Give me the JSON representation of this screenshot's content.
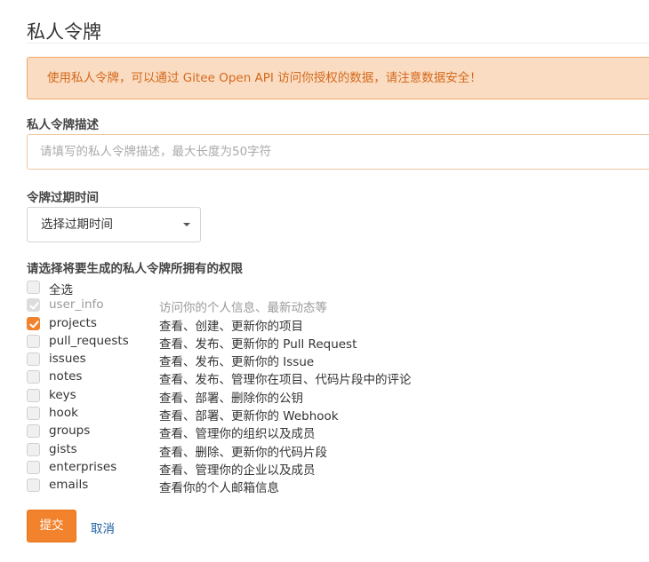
{
  "page": {
    "title": "私人令牌",
    "notice": "使用私人令牌，可以通过 Gitee Open API 访问你授权的数据，请注意数据安全！"
  },
  "form": {
    "description": {
      "label": "私人令牌描述",
      "placeholder": "请填写的私人令牌描述，最大长度为50字符",
      "value": ""
    },
    "expiry": {
      "label": "令牌过期时间",
      "selected": "选择过期时间"
    },
    "permissions": {
      "label": "请选择将要生成的私人令牌所拥有的权限",
      "select_all": {
        "name": "全选",
        "checked": false
      },
      "items": [
        {
          "name": "user_info",
          "desc": "访问你的个人信息、最新动态等",
          "checked": true,
          "disabled": true
        },
        {
          "name": "projects",
          "desc": "查看、创建、更新你的项目",
          "checked": true,
          "disabled": false
        },
        {
          "name": "pull_requests",
          "desc": "查看、发布、更新你的 Pull Request",
          "checked": false,
          "disabled": false
        },
        {
          "name": "issues",
          "desc": "查看、发布、更新你的 Issue",
          "checked": false,
          "disabled": false
        },
        {
          "name": "notes",
          "desc": "查看、发布、管理你在项目、代码片段中的评论",
          "checked": false,
          "disabled": false
        },
        {
          "name": "keys",
          "desc": "查看、部署、删除你的公钥",
          "checked": false,
          "disabled": false
        },
        {
          "name": "hook",
          "desc": "查看、部署、更新你的 Webhook",
          "checked": false,
          "disabled": false
        },
        {
          "name": "groups",
          "desc": "查看、管理你的组织以及成员",
          "checked": false,
          "disabled": false
        },
        {
          "name": "gists",
          "desc": "查看、删除、更新你的代码片段",
          "checked": false,
          "disabled": false
        },
        {
          "name": "enterprises",
          "desc": "查看、管理你的企业以及成员",
          "checked": false,
          "disabled": false
        },
        {
          "name": "emails",
          "desc": "查看你的个人邮箱信息",
          "checked": false,
          "disabled": false
        }
      ]
    },
    "submit_label": "提交",
    "cancel_label": "取消"
  },
  "colors": {
    "accent": "#f2822b",
    "notice_bg": "#fadcc2",
    "notice_text": "#d4691c",
    "link": "#1f5fa3"
  }
}
